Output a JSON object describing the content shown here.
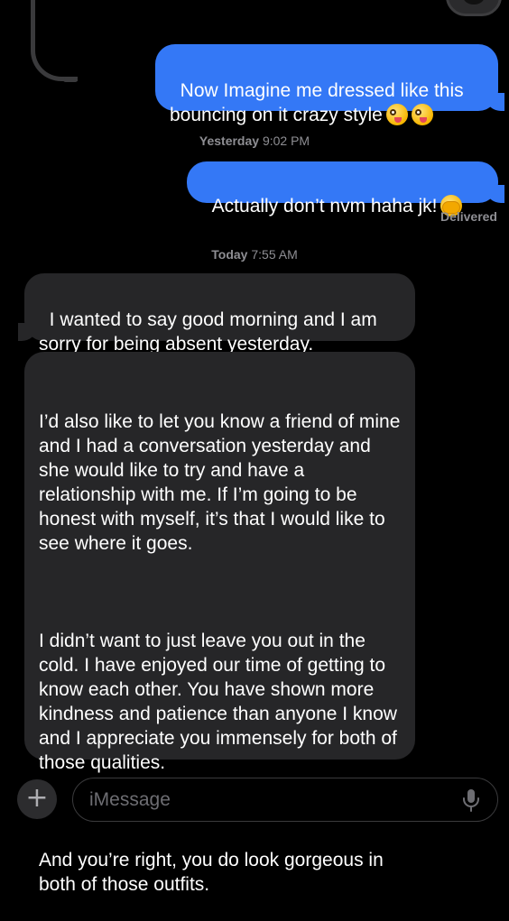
{
  "conversation": {
    "messages": [
      {
        "id": "m1",
        "from": "me",
        "text": "Now Imagine me dressed like this bouncing on it crazy style",
        "emoji": [
          "zany-face",
          "zany-face"
        ]
      },
      {
        "id": "m2",
        "from": "me",
        "text": "Actually don’t nvm haha jk!",
        "emoji": [
          "face-with-open-eyes-and-hand-over-mouth"
        ]
      },
      {
        "id": "m3",
        "from": "them",
        "text": "I wanted to say good morning and I am sorry for being absent yesterday."
      },
      {
        "id": "m4",
        "from": "them",
        "paragraphs": [
          "I’d also like to let you know a friend of mine and I had a conversation yesterday and she would like to try and have a relationship with me. If I’m going to be honest with myself, it’s that I would like to see where it goes.",
          "I didn’t want to just leave you out in the cold. I have enjoyed our time of getting to know each other. You have shown more kindness and patience than anyone I know and I appreciate you immensely for both of those qualities.",
          "And you’re right, you do look gorgeous in both of those outfits."
        ]
      }
    ],
    "timestamps": {
      "yesterday_day": "Yesterday",
      "yesterday_time": "9:02 PM",
      "today_day": "Today",
      "today_time": "7:55 AM"
    },
    "delivered_label": "Delivered"
  },
  "composer": {
    "plus_label": "+",
    "placeholder": "iMessage",
    "mic_icon": "microphone-icon"
  },
  "colors": {
    "outgoing_bubble": "#3478f6",
    "incoming_bubble": "#262628",
    "background": "#000000",
    "meta_text": "#8e8e93"
  }
}
